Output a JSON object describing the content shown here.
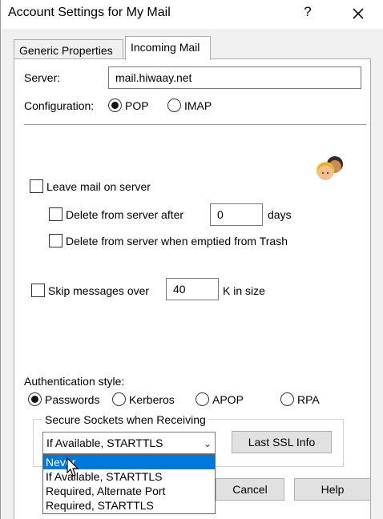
{
  "window": {
    "title": "Account Settings for My Mail",
    "help_glyph": "?",
    "close_icon": "close-icon"
  },
  "tabs": [
    {
      "label": "Generic Properties",
      "active": false
    },
    {
      "label": "Incoming Mail",
      "active": true
    }
  ],
  "server": {
    "label": "Server:",
    "value": "mail.hiwaay.net"
  },
  "configuration": {
    "label": "Configuration:",
    "options": [
      {
        "label": "POP",
        "checked": true
      },
      {
        "label": "IMAP",
        "checked": false
      }
    ]
  },
  "icon": "users-avatar-icon",
  "leave_mail": {
    "label": "Leave mail on server",
    "checked": false
  },
  "delete_after": {
    "label": "Delete from server after",
    "value": "0",
    "unit": "days",
    "checked": false
  },
  "delete_trash": {
    "label": "Delete from server when emptied from Trash",
    "checked": false
  },
  "skip_messages": {
    "label": "Skip messages over",
    "value": "40",
    "unit": "K in size",
    "checked": false
  },
  "auth": {
    "label": "Authentication style:",
    "options": [
      {
        "label": "Passwords",
        "checked": true
      },
      {
        "label": "Kerberos",
        "checked": false
      },
      {
        "label": "APOP",
        "checked": false
      },
      {
        "label": "RPA",
        "checked": false
      }
    ]
  },
  "ssl": {
    "group_label": "Secure Sockets when Receiving",
    "selected": "If Available, STARTTLS",
    "last_ssl_button": "Last SSL Info",
    "options": [
      {
        "label": "Never",
        "highlighted": true
      },
      {
        "label": "If Available, STARTTLS",
        "highlighted": false
      },
      {
        "label": "Required, Alternate Port",
        "highlighted": false
      },
      {
        "label": "Required, STARTTLS",
        "highlighted": false
      }
    ]
  },
  "footer": {
    "cancel_label": "Cancel",
    "help_label": "Help"
  },
  "colors": {
    "highlight": "#0078d7",
    "background": "#f0f0f0",
    "panel": "#ffffff"
  }
}
